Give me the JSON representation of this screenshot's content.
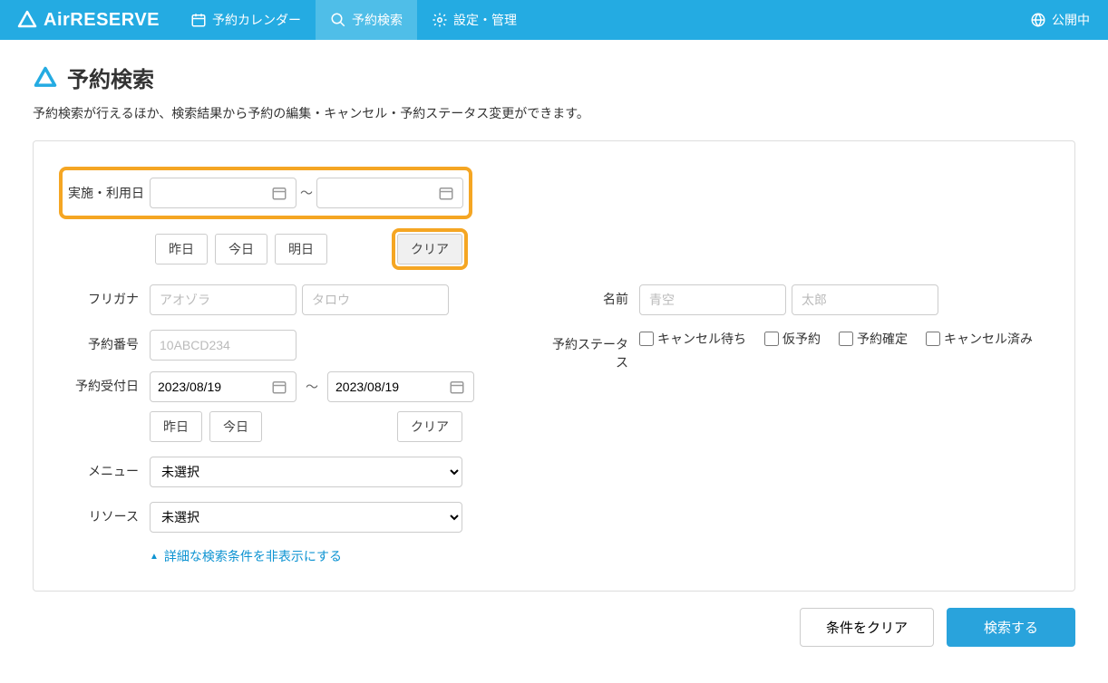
{
  "header": {
    "logo": "AirRESERVE",
    "nav": {
      "calendar": "予約カレンダー",
      "search": "予約検索",
      "settings": "設定・管理"
    },
    "status": "公開中"
  },
  "page": {
    "title": "予約検索",
    "description": "予約検索が行えるほか、検索結果から予約の編集・キャンセル・予約ステータス変更ができます。"
  },
  "form": {
    "use_date": {
      "label": "実施・利用日",
      "from": "",
      "to": "",
      "yesterday": "昨日",
      "today": "今日",
      "tomorrow": "明日",
      "clear": "クリア"
    },
    "furigana": {
      "label": "フリガナ",
      "last_ph": "アオゾラ",
      "first_ph": "タロウ"
    },
    "name": {
      "label": "名前",
      "last_ph": "青空",
      "first_ph": "太郎"
    },
    "number": {
      "label": "予約番号",
      "ph": "10ABCD234"
    },
    "status": {
      "label": "予約ステータス",
      "wait": "キャンセル待ち",
      "provisional": "仮予約",
      "confirmed": "予約確定",
      "cancelled": "キャンセル済み"
    },
    "receipt_date": {
      "label": "予約受付日",
      "from": "2023/08/19",
      "to": "2023/08/19",
      "yesterday": "昨日",
      "today": "今日",
      "clear": "クリア"
    },
    "menu": {
      "label": "メニュー",
      "value": "未選択"
    },
    "resource": {
      "label": "リソース",
      "value": "未選択"
    },
    "toggle": "詳細な検索条件を非表示にする"
  },
  "footer": {
    "clear": "条件をクリア",
    "search": "検索する"
  }
}
